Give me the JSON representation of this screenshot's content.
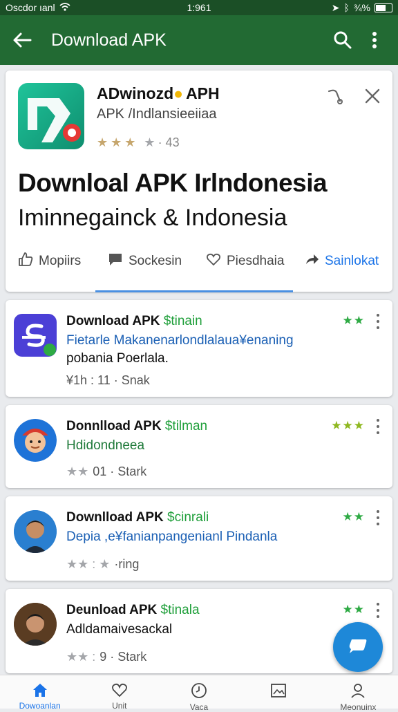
{
  "status_bar": {
    "carrier": "Oscdor ıanl",
    "time": "1:961",
    "battery_text": "¾%"
  },
  "app_bar": {
    "title": "Download APK"
  },
  "hero": {
    "app_name": "ADwinozd",
    "app_name_suffix": "APH",
    "app_sub": "APK /Indlansieeiiaa",
    "rating_text": "· 43",
    "headline": "Downloal APK Irlndonesia",
    "subheadline": "Iminnegainck & Indonesia",
    "tabs": [
      "Mopiirs",
      "Sockesin",
      "Piesdhaia",
      "Sainlokat"
    ]
  },
  "cards": [
    {
      "title": "Download APK",
      "tag": "$tinain",
      "desc_line1": "Fietarle Makanenarlondlalaua¥enaning",
      "desc_line2": "pobania Poerlala.",
      "meta": "¥1h : 11 · Snak",
      "gstars": "★★"
    },
    {
      "title": "Donnlload APK",
      "tag": "$tilman",
      "desc_line1": "Hdidondneea",
      "meta": "01 · Stark",
      "gstars": "★★★"
    },
    {
      "title": "Downlload APK",
      "tag": "$cinrali",
      "desc_line1": "Depia ,e¥fanianpangenianl Pindanla",
      "meta": "·ring",
      "gstars": "★★"
    },
    {
      "title": "Deunload APK",
      "tag": "$tinala",
      "desc_line1": "Adldamaivesackal",
      "meta": "9 · Stark",
      "gstars": "★★"
    }
  ],
  "bottom_nav": [
    "Dowoanlan",
    "Unit",
    "Vaca",
    "",
    "Meonuinx"
  ],
  "colors": {
    "app_bar": "#226a33",
    "accent": "#1a73e8",
    "green_tag": "#1f9f3a",
    "fab": "#1e88d8"
  }
}
